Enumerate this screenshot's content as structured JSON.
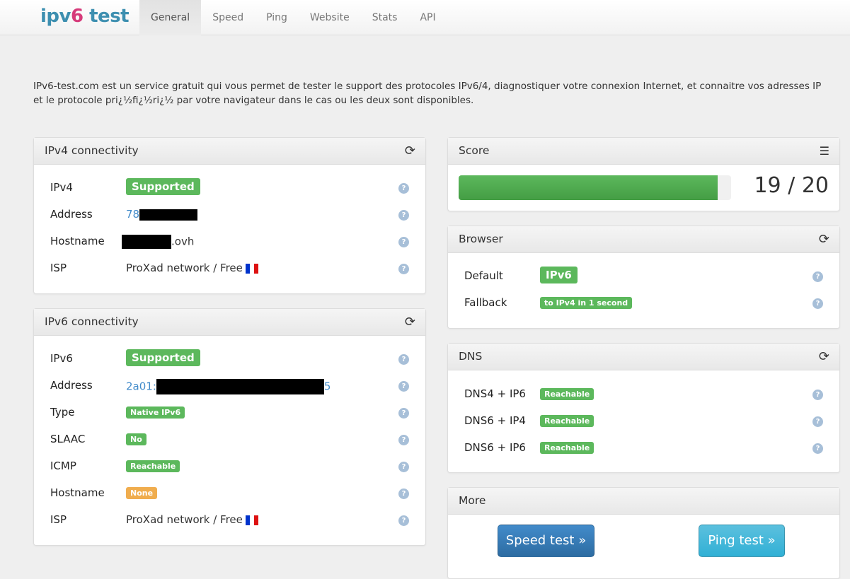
{
  "header": {
    "logo_a": "ipv",
    "logo_b": "6",
    "logo_c": " test",
    "tabs": [
      "General",
      "Speed",
      "Ping",
      "Website",
      "Stats",
      "API"
    ],
    "active_tab": "General"
  },
  "intro": "IPv6-test.com est un service gratuit qui vous permet de tester le support des protocoles IPv6/4, diagnostiquer votre connexion Internet, et connaitre vos adresses IP et le protocole pri¿½fi¿½ri¿½ par votre navigateur dans le cas ou les deux sont disponibles.",
  "ipv4": {
    "title": "IPv4 connectivity",
    "rows": {
      "ipv4": {
        "label": "IPv4",
        "value": "Supported"
      },
      "address": {
        "label": "Address",
        "value_prefix": "78"
      },
      "hostname": {
        "label": "Hostname",
        "value_suffix": ".ovh"
      },
      "isp": {
        "label": "ISP",
        "value": "ProXad network / Free"
      }
    }
  },
  "ipv6": {
    "title": "IPv6 connectivity",
    "rows": {
      "ipv6": {
        "label": "IPv6",
        "value": "Supported"
      },
      "address": {
        "label": "Address",
        "value_prefix": "2a01:",
        "value_suffix": "5"
      },
      "type": {
        "label": "Type",
        "value": "Native IPv6"
      },
      "slaac": {
        "label": "SLAAC",
        "value": "No"
      },
      "icmp": {
        "label": "ICMP",
        "value": "Reachable"
      },
      "hostname": {
        "label": "Hostname",
        "value": "None"
      },
      "isp": {
        "label": "ISP",
        "value": "ProXad network / Free"
      }
    }
  },
  "score": {
    "title": "Score",
    "text": "19 / 20",
    "value": 19,
    "max": 20
  },
  "browser": {
    "title": "Browser",
    "default": {
      "label": "Default",
      "value": "IPv6"
    },
    "fallback": {
      "label": "Fallback",
      "value": "to IPv4 in 1 second"
    }
  },
  "dns": {
    "title": "DNS",
    "rows": [
      {
        "label": "DNS4 + IP6",
        "value": "Reachable"
      },
      {
        "label": "DNS6 + IP4",
        "value": "Reachable"
      },
      {
        "label": "DNS6 + IP6",
        "value": "Reachable"
      }
    ]
  },
  "more": {
    "title": "More",
    "speed_button": "Speed test »",
    "ping_button": "Ping test »"
  },
  "colors": {
    "success": "#5cb85c",
    "warning": "#f0ad4e",
    "primary": "#428bca",
    "info": "#5bc0de"
  }
}
